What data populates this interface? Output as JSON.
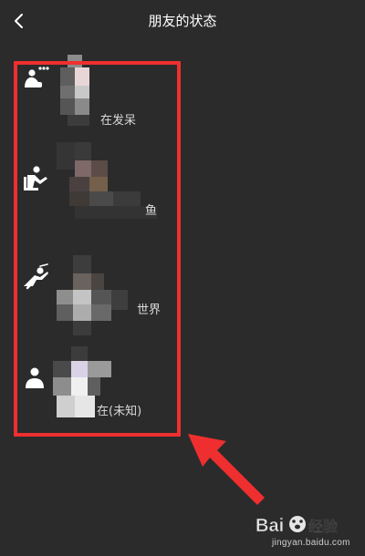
{
  "header": {
    "title": "朋友的状态",
    "back_icon": "chevron-left-icon"
  },
  "statuses": [
    {
      "icon": "zoning-out-icon",
      "label": "在发呆"
    },
    {
      "icon": "slacking-off-icon",
      "label": "鱼"
    },
    {
      "icon": "flying-icon",
      "label": "世界"
    },
    {
      "icon": "person-icon",
      "label": "在(未知)"
    }
  ],
  "colors": {
    "background": "#2b2b2b",
    "highlight": "#ef2f2f",
    "text": "#ffffff"
  },
  "watermark": {
    "logo_text": "Bai经验",
    "url": "jingyan.baidu.com"
  }
}
